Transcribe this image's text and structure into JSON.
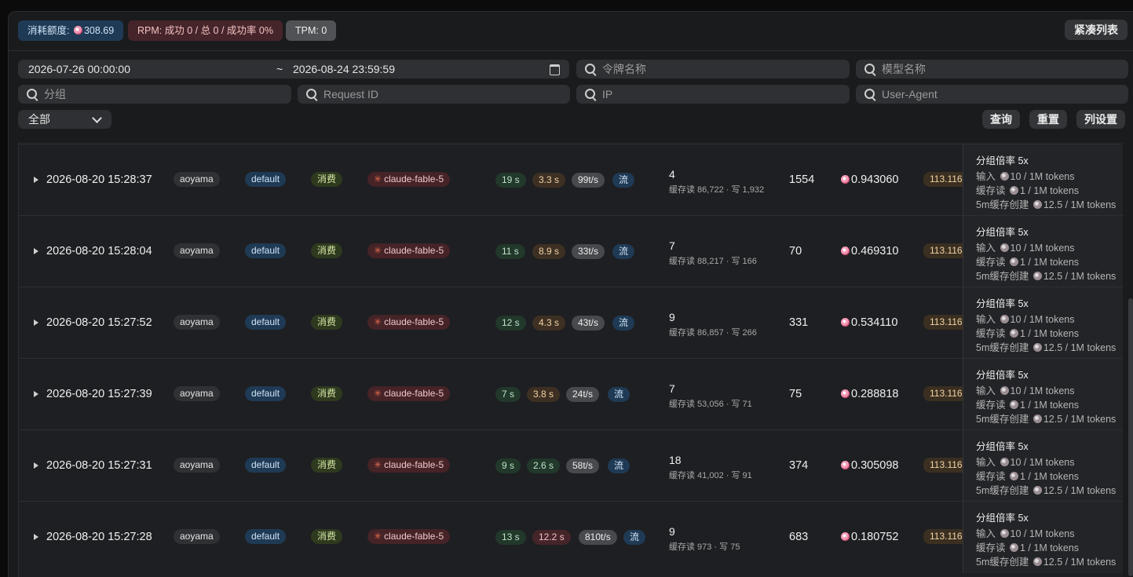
{
  "stats": {
    "consumed_label": "消耗额度:",
    "consumed_value": "308.69",
    "rpm": "RPM: 成功 0 / 总 0 / 成功率 0%",
    "tpm": "TPM: 0",
    "compact_label": "紧凑列表"
  },
  "filters": {
    "date_start": "2026-07-26 00:00:00",
    "date_sep": "~",
    "date_end": "2026-08-24 23:59:59",
    "token_placeholder": "令牌名称",
    "model_placeholder": "模型名称",
    "group_placeholder": "分组",
    "request_id_placeholder": "Request ID",
    "ip_placeholder": "IP",
    "ua_placeholder": "User-Agent",
    "type_selected": "全部",
    "query_label": "查询",
    "reset_label": "重置",
    "columns_label": "列设置"
  },
  "rows": [
    {
      "time": "2026-08-20 15:28:37",
      "user": "aoyama",
      "group": "default",
      "type": "消费",
      "model": "claude-fable-5",
      "t1": "19 s",
      "t1c": "green",
      "t2": "3.3 s",
      "t2c": "amber",
      "speed": "99t/s",
      "stream": "流",
      "prompt": "4",
      "cache": "缓存读 86,722 · 写 1,932",
      "completion": "1554",
      "cost": "0.943060",
      "price": "113.116"
    },
    {
      "time": "2026-08-20 15:28:04",
      "user": "aoyama",
      "group": "default",
      "type": "消费",
      "model": "claude-fable-5",
      "t1": "11 s",
      "t1c": "green",
      "t2": "8.9 s",
      "t2c": "amber",
      "speed": "33t/s",
      "stream": "流",
      "prompt": "7",
      "cache": "缓存读 88,217 · 写 166",
      "completion": "70",
      "cost": "0.469310",
      "price": "113.116"
    },
    {
      "time": "2026-08-20 15:27:52",
      "user": "aoyama",
      "group": "default",
      "type": "消费",
      "model": "claude-fable-5",
      "t1": "12 s",
      "t1c": "green",
      "t2": "4.3 s",
      "t2c": "amber",
      "speed": "43t/s",
      "stream": "流",
      "prompt": "9",
      "cache": "缓存读 86,857 · 写 266",
      "completion": "331",
      "cost": "0.534110",
      "price": "113.116"
    },
    {
      "time": "2026-08-20 15:27:39",
      "user": "aoyama",
      "group": "default",
      "type": "消费",
      "model": "claude-fable-5",
      "t1": "7 s",
      "t1c": "green",
      "t2": "3.8 s",
      "t2c": "amber",
      "speed": "24t/s",
      "stream": "流",
      "prompt": "7",
      "cache": "缓存读 53,056 · 写 71",
      "completion": "75",
      "cost": "0.288818",
      "price": "113.116"
    },
    {
      "time": "2026-08-20 15:27:31",
      "user": "aoyama",
      "group": "default",
      "type": "消费",
      "model": "claude-fable-5",
      "t1": "9 s",
      "t1c": "green",
      "t2": "2.6 s",
      "t2c": "green",
      "speed": "58t/s",
      "stream": "流",
      "prompt": "18",
      "cache": "缓存读 41,002 · 写 91",
      "completion": "374",
      "cost": "0.305098",
      "price": "113.116"
    },
    {
      "time": "2026-08-20 15:27:28",
      "user": "aoyama",
      "group": "default",
      "type": "消费",
      "model": "claude-fable-5",
      "t1": "13 s",
      "t1c": "green",
      "t2": "12.2 s",
      "t2c": "red",
      "speed": "810t/s",
      "stream": "流",
      "prompt": "9",
      "cache": "缓存读 973 · 写 75",
      "completion": "683",
      "cost": "0.180752",
      "price": "113.116"
    }
  ],
  "detail": {
    "title": "分组倍率 5x",
    "input_label": "输入",
    "input_value": "10 / 1M tokens",
    "cache_read_label": "缓存读",
    "cache_read_value": "1 / 1M tokens",
    "cache_create_label": "5m缓存创建",
    "cache_create_value": "12.5 / 1M tokens"
  }
}
